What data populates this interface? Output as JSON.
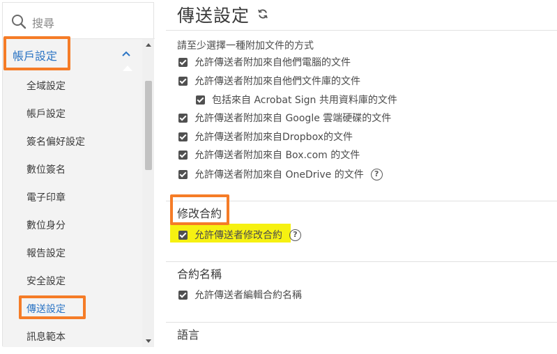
{
  "sidebar": {
    "search_placeholder": "搜尋",
    "account_header": "帳戶設定",
    "items": [
      {
        "label": "全域設定"
      },
      {
        "label": "帳戶設定"
      },
      {
        "label": "簽名偏好設定"
      },
      {
        "label": "數位簽名"
      },
      {
        "label": "電子印章"
      },
      {
        "label": "數位身分"
      },
      {
        "label": "報告設定"
      },
      {
        "label": "安全設定"
      },
      {
        "label": "傳送設定",
        "active": true
      },
      {
        "label": "訊息範本"
      }
    ]
  },
  "main": {
    "title": "傳送設定",
    "attach_section": {
      "subtitle": "請至少選擇一種附加文件的方式",
      "options": [
        {
          "label": "允許傳送者附加來自他們電腦的文件",
          "checked": true
        },
        {
          "label": "允許傳送者附加來自他們文件庫的文件",
          "checked": true
        },
        {
          "label": "包括來自 Acrobat Sign 共用資料庫的文件",
          "checked": true
        },
        {
          "label": "允許傳送者附加來自 Google 雲端硬碟的文件",
          "checked": true
        },
        {
          "label": "允許傳送者附加來自Dropbox的文件",
          "checked": true
        },
        {
          "label": "允許傳送者附加來自 Box.com 的文件",
          "checked": true
        },
        {
          "label": "允許傳送者附加來自 OneDrive 的文件",
          "checked": true,
          "help": "?"
        }
      ]
    },
    "modify_section": {
      "heading": "修改合約",
      "option": {
        "label": "允許傳送者修改合約",
        "checked": true,
        "help": "?"
      }
    },
    "name_section": {
      "heading": "合約名稱",
      "option": {
        "label": "允許傳送者編輯合約名稱",
        "checked": true
      }
    },
    "language_section": {
      "heading": "語言"
    }
  },
  "colors": {
    "accent_blue": "#2b74c4",
    "highlight_orange": "#f57c27",
    "highlight_yellow": "#f6f111"
  }
}
